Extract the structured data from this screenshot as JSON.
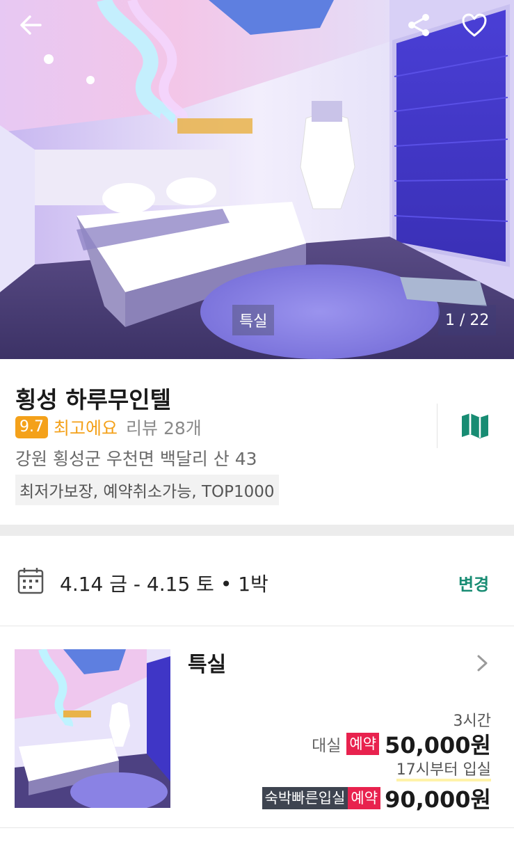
{
  "hero": {
    "room_tag": "특실",
    "photo_counter": "1 / 22"
  },
  "hotel": {
    "name": "횡성 하루무인텔",
    "score": "9.7",
    "rating_word": "최고에요",
    "review_count": "리뷰 28개",
    "address": "강원 횡성군 우천면 백달리 산 43",
    "tags": "최저가보장, 예약취소가능, TOP1000"
  },
  "booking": {
    "date_range": "4.14 금 - 4.15 토  •  1박",
    "change_label": "변경"
  },
  "room": {
    "name": "특실",
    "rent_duration": "3시간",
    "rent_label": "대실",
    "rent_badge": "예약",
    "rent_price": "50,000원",
    "checkin_note": "17시부터 입실",
    "stay_badge": "숙박빠른입실",
    "stay_reserve_badge": "예약",
    "stay_price": "90,000원"
  },
  "icons": {
    "back": "arrow-left-icon",
    "share": "share-icon",
    "favorite": "heart-icon",
    "map": "map-icon",
    "calendar": "calendar-icon",
    "detail": "chevron-right-icon"
  },
  "colors": {
    "rating": "#f4a11a",
    "accent_green": "#188c73",
    "reserve_red": "#e8224e",
    "dark_badge": "#3e4450"
  }
}
